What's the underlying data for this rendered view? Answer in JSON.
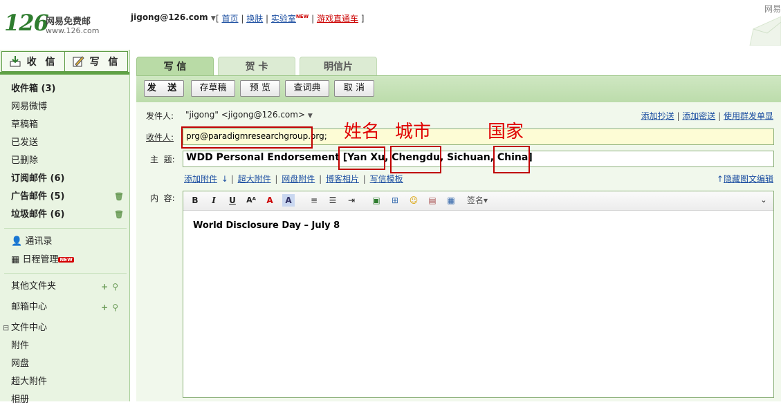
{
  "header": {
    "logo_number": "126",
    "logo_text": "网易免费邮",
    "logo_url": "www.126.com",
    "user": "jigong@126.com",
    "links": [
      "首页",
      "换肤",
      "实验室",
      "游戏直通车"
    ],
    "lab_badge": "NEW",
    "brand_right": "网易"
  },
  "sidebar": {
    "receive": "收 信",
    "write": "写 信",
    "folders": [
      {
        "label": "收件箱 (3)",
        "bold": true
      },
      {
        "label": "网易微博",
        "bold": false
      },
      {
        "label": "草稿箱",
        "bold": false
      },
      {
        "label": "已发送",
        "bold": false
      },
      {
        "label": "已删除",
        "bold": false
      },
      {
        "label": "订阅邮件 (6)",
        "bold": true
      },
      {
        "label": "广告邮件 (5)",
        "bold": true
      },
      {
        "label": "垃圾邮件 (6)",
        "bold": true
      }
    ],
    "contacts": "通讯录",
    "calendar": "日程管理",
    "calendar_badge": "NEW",
    "other_folders": "其他文件夹",
    "mailbox_center": "邮箱中心",
    "file_center": "文件中心",
    "file_items": [
      "附件",
      "网盘",
      "超大附件",
      "相册"
    ]
  },
  "tabs": [
    "写 信",
    "贺 卡",
    "明信片"
  ],
  "toolbar": {
    "send": "发 送",
    "save_draft": "存草稿",
    "preview": "预 览",
    "dictionary": "查词典",
    "cancel": "取 消"
  },
  "compose": {
    "sender_label": "发件人:",
    "sender_value": "\"jigong\" <jigong@126.com>",
    "right_links": [
      "添加抄送",
      "添加密送",
      "使用群发单显"
    ],
    "to_label": "收件人:",
    "to_value": "prg@paradigmresearchgroup.org;",
    "subject_label": "主  题:",
    "subject_value": "WDD Personal Endorsement [Yan Xu, Chengdu, Sichuan, China]",
    "attach_links": [
      "添加附件",
      "超大附件",
      "网盘附件",
      "博客相片",
      "写信模板"
    ],
    "hide_editor": "隐藏图文编辑",
    "content_label": "内  容:",
    "signature": "签名",
    "body": "World Disclosure Day – July 8"
  },
  "annotations": {
    "name": "姓名",
    "city": "城市",
    "country": "国家"
  },
  "colors": {
    "accent_green": "#5fa245",
    "sidebar_bg": "#e9f4e2",
    "link_blue": "#1e50a2",
    "annotation_red": "#e00000"
  }
}
